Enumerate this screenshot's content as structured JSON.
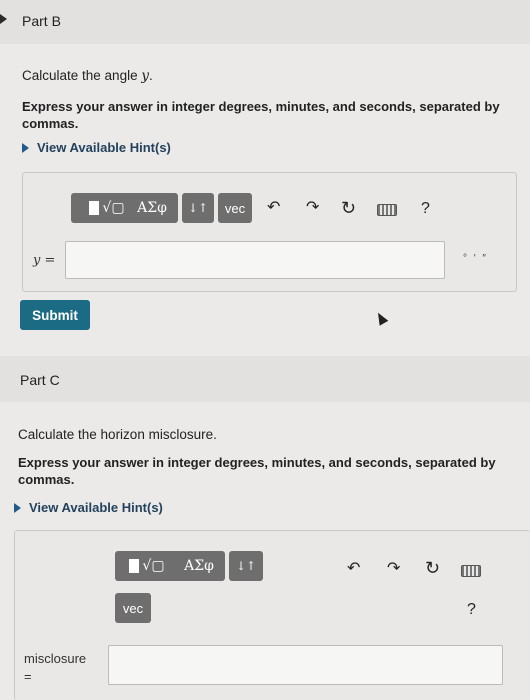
{
  "partB": {
    "title": "Part B",
    "question_prefix": "Calculate the angle ",
    "question_var": "y",
    "question_suffix": ".",
    "instruction": "Express your answer in integer degrees, minutes, and seconds, separated by commas.",
    "hint_label": "View Available Hint(s)",
    "toolbar": {
      "matrix_label": "√▢",
      "greek_label": "ΑΣφ",
      "arrows_label": "↓↑",
      "vec_label": "vec",
      "help_label": "?"
    },
    "var_label": "y =",
    "units_label": "° ′ ″",
    "submit_label": "Submit"
  },
  "partC": {
    "title": "Part C",
    "question": "Calculate the horizon misclosure.",
    "instruction": "Express your answer in integer degrees, minutes, and seconds, separated by commas.",
    "hint_label": "View Available Hint(s)",
    "toolbar": {
      "matrix_label": "√▢",
      "greek_label": "ΑΣφ",
      "arrows_label": "↓↑",
      "vec_label": "vec",
      "help_label": "?"
    },
    "var_label_line1": "misclosure",
    "var_label_line2": "="
  }
}
